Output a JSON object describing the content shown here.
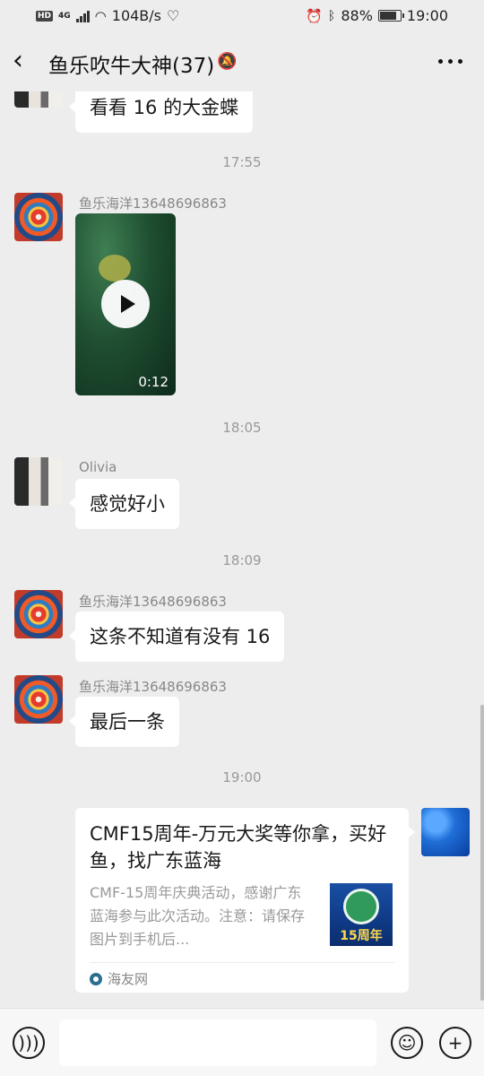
{
  "status_bar": {
    "hd": "HD",
    "network": "4G",
    "speed": "104B/s",
    "battery": "88%",
    "battery_level": 0.88,
    "time": "19:00"
  },
  "header": {
    "back_icon": "chevron-left-icon",
    "title": "鱼乐吹牛大神(37)",
    "mute_icon": "bell-off-icon",
    "more_icon": "more-dots-icon"
  },
  "messages": [
    {
      "type": "text",
      "text": "看看 16 的大金蝶"
    },
    {
      "type": "time",
      "text": "17:55"
    },
    {
      "type": "video",
      "sender": "鱼乐海洋13648696863",
      "duration": "0:12"
    },
    {
      "type": "time",
      "text": "18:05"
    },
    {
      "type": "text",
      "sender": "Olivia",
      "text": "感觉好小"
    },
    {
      "type": "time",
      "text": "18:09"
    },
    {
      "type": "text",
      "sender": "鱼乐海洋13648696863",
      "text": "这条不知道有没有 16"
    },
    {
      "type": "text",
      "sender": "鱼乐海洋13648696863",
      "text": "最后一条"
    },
    {
      "type": "time",
      "text": "19:00"
    },
    {
      "type": "link",
      "title": "CMF15周年-万元大奖等你拿，买好鱼，找广东蓝海",
      "description": "CMF-15周年庆典活动，感谢广东蓝海参与此次活动。注意：请保存图片到手机后...",
      "thumb_label": "15周年",
      "source": "海友网"
    }
  ],
  "input_bar": {
    "voice_icon": "voice-icon",
    "emoji_icon": "emoji-icon",
    "plus_icon": "plus-icon",
    "text_value": ""
  }
}
